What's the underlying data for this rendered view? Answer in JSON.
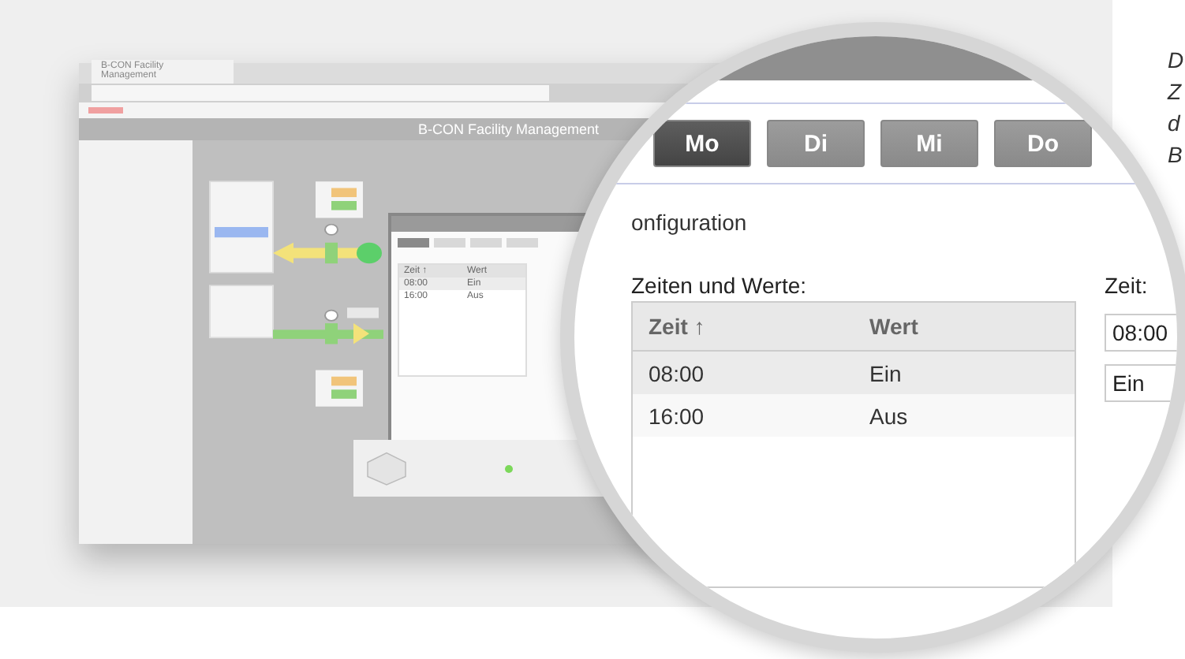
{
  "screenshot": {
    "browser_tab": {
      "title": "B-CON Facility Management"
    },
    "app_title": "B-CON Facility Management",
    "dialog": {
      "table": {
        "columns": [
          "Zeit ↑",
          "Wert"
        ],
        "rows": [
          {
            "cells": [
              "08:00",
              "Ein"
            ],
            "selected": true
          },
          {
            "cells": [
              "16:00",
              "Aus"
            ],
            "selected": false
          }
        ]
      }
    }
  },
  "magnifier": {
    "day_buttons": [
      {
        "label": "Mo",
        "selected": true
      },
      {
        "label": "Di",
        "selected": false
      },
      {
        "label": "Mi",
        "selected": false
      },
      {
        "label": "Do",
        "selected": false
      }
    ],
    "section_title": "onfiguration",
    "list_label": "Zeiten und Werte:",
    "table": {
      "columns": [
        "Zeit ↑",
        "Wert"
      ],
      "rows": [
        {
          "cells": [
            "08:00",
            "Ein"
          ],
          "selected": true
        },
        {
          "cells": [
            "16:00",
            "Aus"
          ],
          "selected": false
        }
      ]
    },
    "time_label": "Zeit:",
    "time_value": "08:00",
    "value_select": "Ein"
  },
  "side_text": [
    "D",
    "Z",
    "d",
    "B"
  ]
}
